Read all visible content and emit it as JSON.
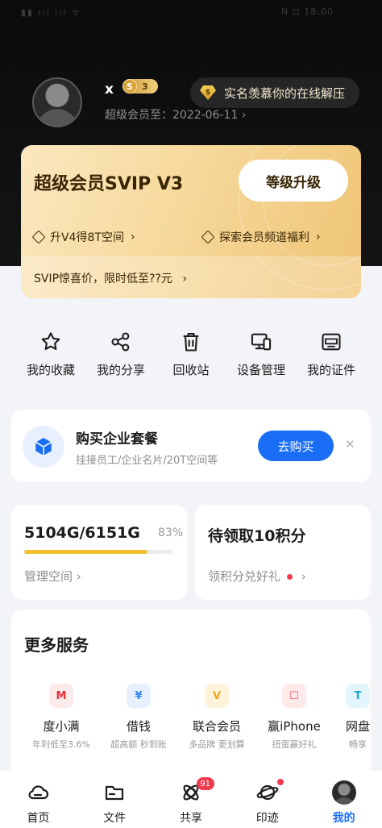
{
  "status_bar": {
    "left": "▮▮ ııl ııl ᯤ",
    "right": "N ⊡ 18:00"
  },
  "profile": {
    "name": "x",
    "level_badge": "3",
    "svip_expire": "超级会员至：2022-06-11",
    "chevron": "›",
    "promo_pill": "实名羡慕你的在线解压"
  },
  "vip_card": {
    "title": "超级会员SVIP V3",
    "upgrade_button": "等级升级",
    "perk_left": "升V4得8T空间",
    "perk_right": "探索会员频道福利",
    "promo": "SVIP惊喜价，限时低至??元"
  },
  "quick_actions": [
    {
      "label": "我的收藏",
      "icon": "star-icon"
    },
    {
      "label": "我的分享",
      "icon": "share-icon"
    },
    {
      "label": "回收站",
      "icon": "trash-icon"
    },
    {
      "label": "设备管理",
      "icon": "devices-icon"
    },
    {
      "label": "我的证件",
      "icon": "id-card-icon"
    }
  ],
  "enterprise": {
    "title": "购买企业套餐",
    "subtitle": "挂接员工/企业名片/20T空间等",
    "button": "去购买",
    "close": "✕"
  },
  "storage": {
    "usage": "5104G/6151G",
    "percent": "83%",
    "fraction": 0.83,
    "link": "管理空间 ›"
  },
  "points": {
    "title": "待领取10积分",
    "link": "领积分兑好礼"
  },
  "more_services": {
    "title": "更多服务",
    "items": [
      {
        "name": "度小满",
        "desc": "年利低至3.6%",
        "icon": "duxiaoman-icon",
        "color": "#e8333a"
      },
      {
        "name": "借钱",
        "desc": "超高额 秒到账",
        "icon": "money-bag-icon",
        "color": "#2f84f0"
      },
      {
        "name": "联合会员",
        "desc": "多品牌 更划算",
        "icon": "vip-ticket-icon",
        "color": "#f2a623"
      },
      {
        "name": "赢iPhone",
        "desc": "扭蛋赢好礼",
        "icon": "gift-icon",
        "color": "#f0585e"
      },
      {
        "name": "网盘",
        "desc": "畅享",
        "icon": "cloud-tv-icon",
        "color": "#1aa7d8"
      }
    ]
  },
  "tabbar": {
    "items": [
      {
        "label": "首页",
        "icon": "home-cloud-icon"
      },
      {
        "label": "文件",
        "icon": "folder-icon"
      },
      {
        "label": "共享",
        "icon": "share-planet-icon",
        "badge": "91"
      },
      {
        "label": "印迹",
        "icon": "planet-icon"
      },
      {
        "label": "我的",
        "icon": "avatar"
      }
    ]
  }
}
